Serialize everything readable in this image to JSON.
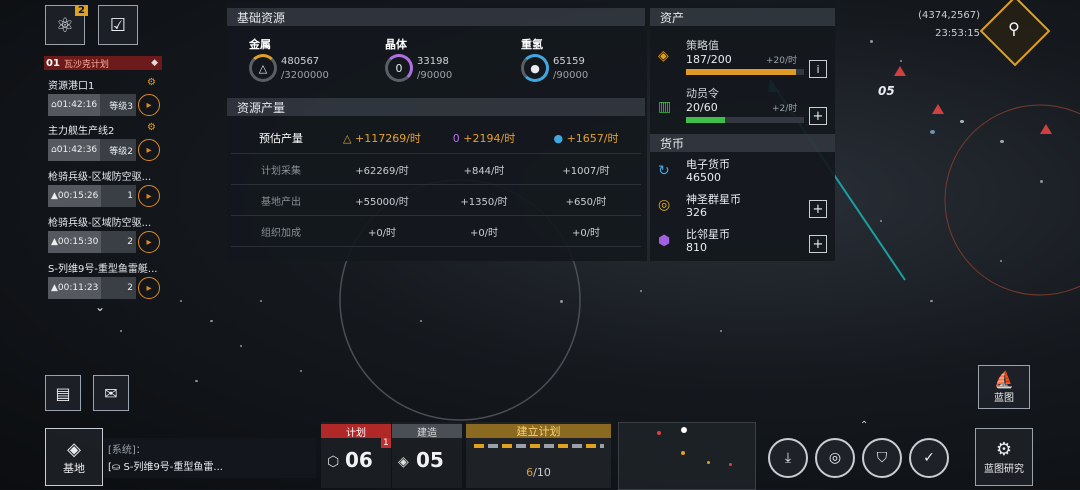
{
  "top_right": {
    "coords": "(4374,2567)",
    "time": "23:53:15"
  },
  "left": {
    "badge_count": "2",
    "plan_header": {
      "index": "01",
      "label": "瓦沙克计划"
    },
    "plan_items": [
      {
        "title": "资源港口1",
        "time": "01:42:16",
        "level": "等级3"
      },
      {
        "title": "主力舰生产线2",
        "time": "01:42:36",
        "level": "等级2"
      },
      {
        "title": "枪骑兵级-区域防空驱...",
        "time": "00:15:26",
        "level": "1"
      },
      {
        "title": "枪骑兵级-区域防空驱...",
        "time": "00:15:30",
        "level": "2"
      },
      {
        "title": "S-列维9号-重型鱼雷艇...",
        "time": "00:11:23",
        "level": "2"
      }
    ]
  },
  "resources": {
    "title": "基础资源",
    "items": [
      {
        "name": "金属",
        "current": "480567",
        "cap": "/3200000"
      },
      {
        "name": "晶体",
        "current": "33198",
        "cap": "/90000"
      },
      {
        "name": "重氢",
        "current": "65159",
        "cap": "/90000"
      }
    ]
  },
  "production": {
    "title": "资源产量",
    "rows": [
      {
        "label": "预估产量",
        "metal": "+117269/时",
        "crystal": "+2194/时",
        "deut": "+1657/时"
      },
      {
        "label": "计划采集",
        "metal": "+62269/时",
        "crystal": "+844/时",
        "deut": "+1007/时"
      },
      {
        "label": "基地产出",
        "metal": "+55000/时",
        "crystal": "+1350/时",
        "deut": "+650/时"
      },
      {
        "label": "组织加成",
        "metal": "+0/时",
        "crystal": "+0/时",
        "deut": "+0/时"
      }
    ]
  },
  "assets": {
    "title": "资产",
    "strategy": {
      "label": "策略值",
      "value": "187/200",
      "rate": "+20/时",
      "fill": 0.935
    },
    "mobilize": {
      "label": "动员令",
      "value": "20/60",
      "rate": "+2/时",
      "fill": 0.333
    },
    "currency_title": "货币",
    "currencies": [
      {
        "name": "电子货币",
        "value": "46500"
      },
      {
        "name": "神圣群星币",
        "value": "326"
      },
      {
        "name": "比邻星币",
        "value": "810"
      }
    ]
  },
  "bottom": {
    "base_label": "基地",
    "system_label": "[系统]：",
    "system_msg": "S-列维9号-重型鱼雷...",
    "tab_plan": "计划",
    "tab_build": "建造",
    "plan_count": "06",
    "plan_badge": "1",
    "build_count": "05",
    "establish_label": "建立计划",
    "establish_count": "6",
    "establish_total": "/10",
    "blueprint_label": "蓝图",
    "blueprint_research_label": "蓝图研究"
  },
  "map_label": "05",
  "colors": {
    "accent": "#e09a28",
    "green": "#3fbf4a",
    "red_tab": "#c53030"
  }
}
